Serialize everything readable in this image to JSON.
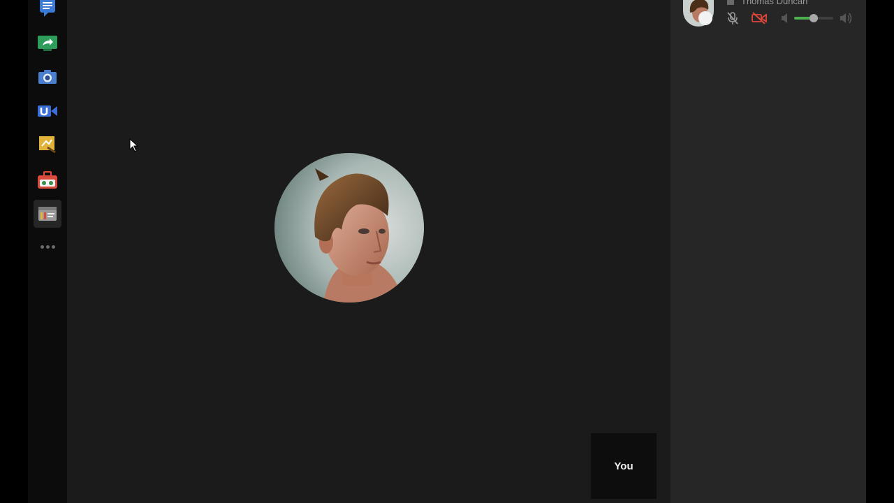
{
  "rail": {
    "apps": [
      {
        "icon": "chat-icon",
        "color": "#3a7bd5"
      },
      {
        "icon": "screenshare-icon",
        "color": "#2e9c5a"
      },
      {
        "icon": "camera-icon",
        "color": "#4a7fd0"
      },
      {
        "icon": "video-effects-icon",
        "color": "#3b6fd6"
      },
      {
        "icon": "sketch-icon",
        "color": "#e2b33a"
      },
      {
        "icon": "toolbox-icon",
        "color": "#d84a3c"
      },
      {
        "icon": "panels-icon",
        "color": "#9a9a9a"
      }
    ],
    "more": "more-apps-icon"
  },
  "stage": {
    "self_label": "You"
  },
  "participants": [
    {
      "name": "Thomas Duncan",
      "muted": true,
      "video_off": true,
      "volume_level": 0.5
    }
  ],
  "colors": {
    "stage_bg": "#1b1b1b",
    "panel_bg": "#262626",
    "mute_red": "#e0473a",
    "volume_green": "#4caf50"
  }
}
